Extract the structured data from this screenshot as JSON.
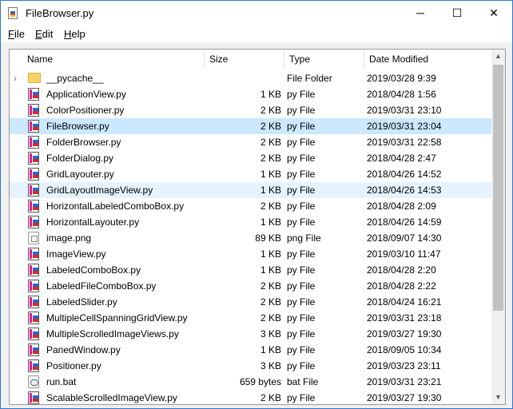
{
  "window": {
    "title": "FileBrowser.py",
    "controls": {
      "minimize": "─",
      "maximize": "☐",
      "close": "✕"
    }
  },
  "menu": [
    {
      "label": "File",
      "mnemonic": "F",
      "rest": "ile"
    },
    {
      "label": "Edit",
      "mnemonic": "E",
      "rest": "dit"
    },
    {
      "label": "Help",
      "mnemonic": "H",
      "rest": "elp"
    }
  ],
  "columns": {
    "name": "Name",
    "size": "Size",
    "type": "Type",
    "modified": "Date Modified"
  },
  "files": [
    {
      "name": "__pycache__",
      "size": "",
      "type": "File Folder",
      "modified": "2019/03/28 9:39",
      "icon": "folder-icon",
      "expander": "›"
    },
    {
      "name": "ApplicationView.py",
      "size": "1 KB",
      "type": "py File",
      "modified": "2018/04/28 1:56",
      "icon": "py-file-icon"
    },
    {
      "name": "ColorPositioner.py",
      "size": "2 KB",
      "type": "py File",
      "modified": "2019/03/31 23:10",
      "icon": "py-file-icon"
    },
    {
      "name": "FileBrowser.py",
      "size": "2 KB",
      "type": "py File",
      "modified": "2019/03/31 23:04",
      "icon": "py-file-icon",
      "state": "selected"
    },
    {
      "name": "FolderBrowser.py",
      "size": "2 KB",
      "type": "py File",
      "modified": "2019/03/31 22:58",
      "icon": "py-file-icon"
    },
    {
      "name": "FolderDialog.py",
      "size": "2 KB",
      "type": "py File",
      "modified": "2018/04/28 2:47",
      "icon": "py-file-icon"
    },
    {
      "name": "GridLayouter.py",
      "size": "1 KB",
      "type": "py File",
      "modified": "2018/04/26 14:52",
      "icon": "py-file-icon"
    },
    {
      "name": "GridLayoutImageView.py",
      "size": "1 KB",
      "type": "py File",
      "modified": "2018/04/26 14:53",
      "icon": "py-file-icon",
      "state": "hover"
    },
    {
      "name": "HorizontalLabeledComboBox.py",
      "size": "2 KB",
      "type": "py File",
      "modified": "2018/04/28 2:09",
      "icon": "py-file-icon"
    },
    {
      "name": "HorizontalLayouter.py",
      "size": "1 KB",
      "type": "py File",
      "modified": "2018/04/26 14:59",
      "icon": "py-file-icon"
    },
    {
      "name": "image.png",
      "size": "89 KB",
      "type": "png File",
      "modified": "2018/09/07 14:30",
      "icon": "image-file-icon"
    },
    {
      "name": "ImageView.py",
      "size": "1 KB",
      "type": "py File",
      "modified": "2019/03/10 11:47",
      "icon": "py-file-icon"
    },
    {
      "name": "LabeledComboBox.py",
      "size": "1 KB",
      "type": "py File",
      "modified": "2018/04/28 2:20",
      "icon": "py-file-icon"
    },
    {
      "name": "LabeledFileComboBox.py",
      "size": "2 KB",
      "type": "py File",
      "modified": "2018/04/28 2:22",
      "icon": "py-file-icon"
    },
    {
      "name": "LabeledSlider.py",
      "size": "2 KB",
      "type": "py File",
      "modified": "2018/04/24 16:21",
      "icon": "py-file-icon"
    },
    {
      "name": "MultipleCellSpanningGridView.py",
      "size": "2 KB",
      "type": "py File",
      "modified": "2019/03/31 23:18",
      "icon": "py-file-icon"
    },
    {
      "name": "MultipleScrolledImageViews.py",
      "size": "3 KB",
      "type": "py File",
      "modified": "2019/03/27 19:30",
      "icon": "py-file-icon"
    },
    {
      "name": "PanedWindow.py",
      "size": "1 KB",
      "type": "py File",
      "modified": "2018/09/05 10:34",
      "icon": "py-file-icon"
    },
    {
      "name": "Positioner.py",
      "size": "3 KB",
      "type": "py File",
      "modified": "2019/03/23 23:11",
      "icon": "py-file-icon"
    },
    {
      "name": "run.bat",
      "size": "659 bytes",
      "type": "bat File",
      "modified": "2019/03/31 23:21",
      "icon": "bat-file-icon"
    },
    {
      "name": "ScalableScrolledImageView.py",
      "size": "2 KB",
      "type": "py File",
      "modified": "2019/03/27 19:30",
      "icon": "py-file-icon"
    }
  ],
  "scrollbar": {
    "up": "▲",
    "down": "▼"
  }
}
